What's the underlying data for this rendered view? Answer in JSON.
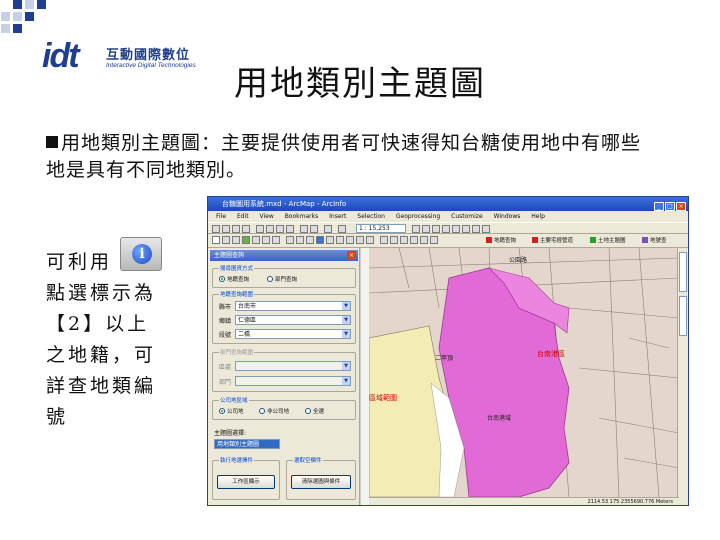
{
  "logo": {
    "mark": "idt",
    "name_cn": "互動國際數位",
    "name_en": "Interactive Digital Technologies"
  },
  "slide": {
    "title": "用地類別主題圖",
    "bullet": "用地類別主題圖：主要提供使用者可快速得知台糖使用地中有哪些地是具有不同地類別。",
    "side_text_before": "可利用",
    "side_text_after": "點選標示為【2】以上之地籍，可詳查地類編號"
  },
  "arcmap": {
    "window_title": "台糖圖用系統.mxd - ArcMap - ArcInfo",
    "menu": [
      "File",
      "Edit",
      "View",
      "Bookmarks",
      "Insert",
      "Selection",
      "Geoprocessing",
      "Customize",
      "Windows",
      "Help"
    ],
    "scale": "1 : 15,253",
    "toolbar2_buttons": [
      "地籍查詢",
      "主要宅經管道",
      "土地主題圖",
      "地號查"
    ],
    "panel": {
      "title": "主題圖查詢",
      "group_search_mode": "搜尋圖資方式",
      "radio_land_parcel": "地籍查詢",
      "radio_dept": "部門查詢",
      "group_parcel_range": "地籍查詢範圍",
      "label_city": "縣市",
      "value_city": "台南市",
      "label_district": "鄉鎮",
      "value_district": "仁德區",
      "label_section": "段號",
      "value_section": "二橋",
      "group_dept_range": "部門查詢範圍",
      "label_region": "區處",
      "label_dept": "部門",
      "group_company": "公司地區域",
      "radio_company": "公司地",
      "radio_non_company": "非公司地",
      "radio_all": "全選",
      "label_theme": "主題圖選擇:",
      "value_theme": "用地類別主題圖",
      "group_parcel_select": "執行地選擇件",
      "group_fields": "選取空欄件",
      "btn_workspace": "工作區顯示",
      "btn_query": "清除選圖與條件"
    },
    "map_labels": [
      "公園路",
      "二甲頂",
      "台南港區",
      "區域範圍",
      "台南港域"
    ],
    "status_text": "2114.53 175  2355690.776 Meters"
  }
}
